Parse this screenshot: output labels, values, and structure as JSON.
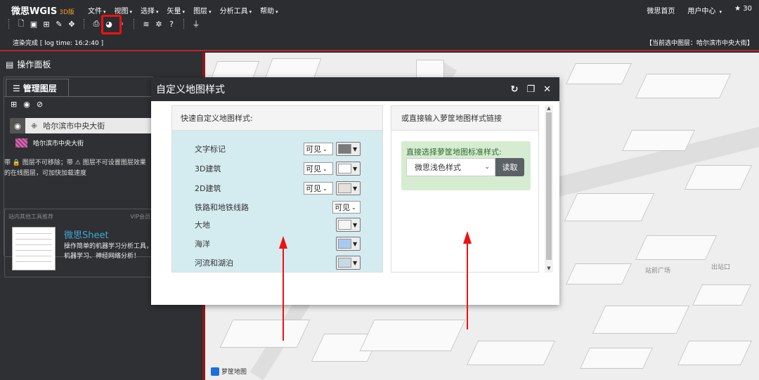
{
  "app": {
    "name": "微思WGIS",
    "version": "3D版"
  },
  "menus": [
    "文件",
    "视图",
    "选择",
    "矢量",
    "图层",
    "分析工具",
    "帮助"
  ],
  "right_links": {
    "home": "微思首页",
    "user": "用户中心",
    "stars": "30"
  },
  "status": {
    "left": "渲染完成 [ log time:  16:2:40 ]",
    "right": "【当前选中图层：哈尔滨市中央大街】"
  },
  "panel": {
    "title": "操作面板",
    "tab_label": "管理图层",
    "layer_name": "哈尔滨市中央大街",
    "sublayer_name": "哈尔滨市中央大街",
    "hint": "带 🔒 图层不可移除；带 ⚠ 图层不可设置图层效果 的在线图层，可加快加载速度"
  },
  "promo": {
    "header_left": "站内其他工具推荐",
    "header_right": "VIP会员",
    "title": "微思Sheet",
    "desc": "操作简单的机器学习分析工具，机器学习、神经网络分析！"
  },
  "map": {
    "labels": {
      "plaza": "站前广场",
      "exit": "出站口"
    },
    "attribution": "萝筐地图"
  },
  "modal": {
    "title": "自定义地图样式",
    "left_header": "快速自定义地图样式:",
    "right_header": "或直接输入萝筐地图样式链接",
    "rows": [
      {
        "label": "文字标记",
        "visibility": "可见",
        "color": "#7a7a7a"
      },
      {
        "label": "3D建筑",
        "visibility": "可见",
        "color": "#ffffff"
      },
      {
        "label": "2D建筑",
        "visibility": "可见",
        "color": "#e6e0da"
      },
      {
        "label": "铁路和地铁线路",
        "visibility": "可见",
        "color": ""
      },
      {
        "label": "大地",
        "visibility": "",
        "color": "#f5f5f5"
      },
      {
        "label": "海洋",
        "visibility": "",
        "color": "#a9c9f2"
      },
      {
        "label": "河流和湖泊",
        "visibility": "",
        "color": "#c8d8e6"
      }
    ],
    "std_style_label": "直接选择萝筐地图标准样式:",
    "std_style_value": "微思浅色样式",
    "read_button": "读取"
  },
  "colors": {
    "accent_red": "#b6262b",
    "highlight": "#e11111",
    "topbar": "#2b2d31",
    "left_pane": "#d4ebf0",
    "right_green": "#d6ecd1"
  }
}
